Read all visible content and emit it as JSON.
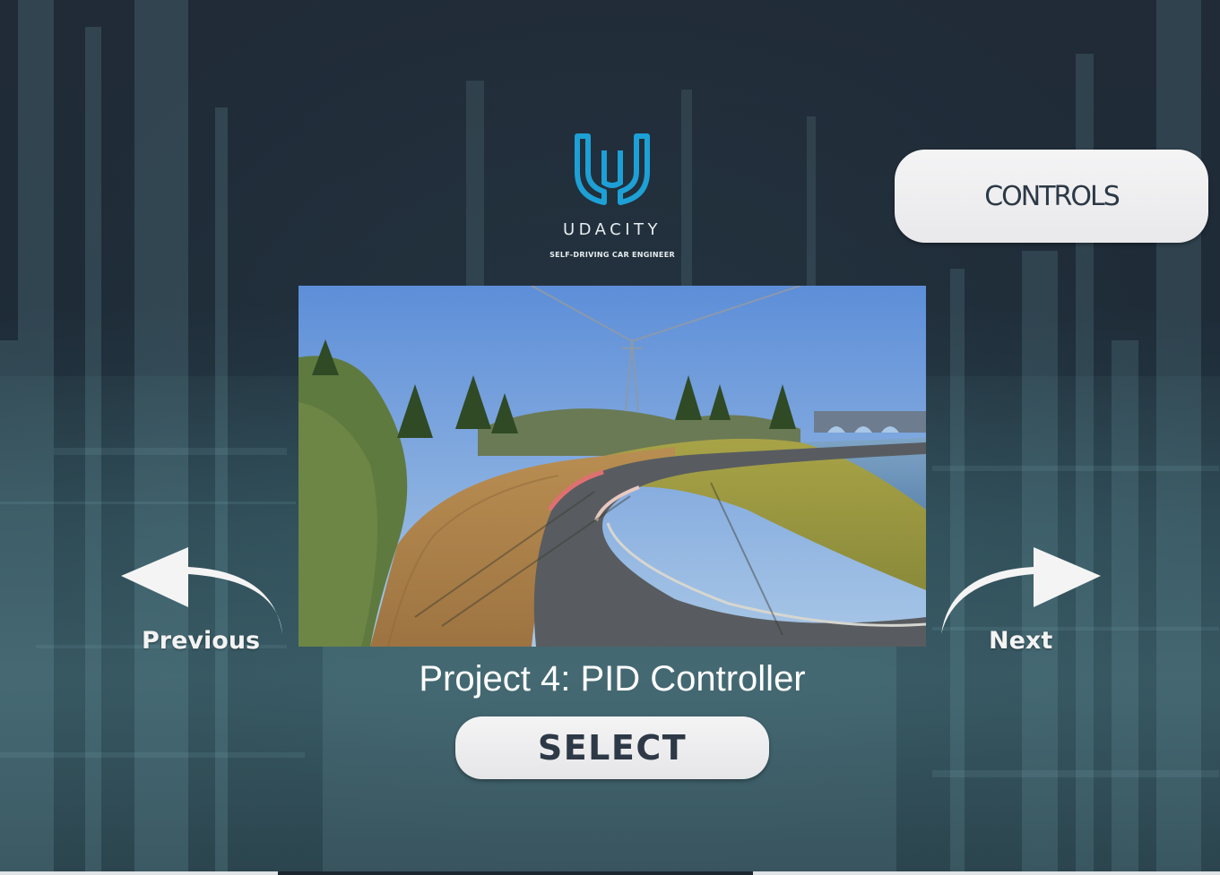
{
  "logo": {
    "wordmark": "UDACITY",
    "tagline": "SELF-DRIVING CAR ENGINEER",
    "icon": "udacity-u-logo",
    "color": "#1da0d6"
  },
  "header": {
    "controls_label": "CONTROLS"
  },
  "navigation": {
    "previous_label": "Previous",
    "next_label": "Next",
    "previous_icon": "curved-arrow-left-icon",
    "next_icon": "curved-arrow-right-icon"
  },
  "project": {
    "title": "Project 4: PID Controller",
    "preview_description_icon": "track-preview-image"
  },
  "actions": {
    "select_label": "SELECT"
  },
  "colors": {
    "background": "#233140",
    "button_bg": "#efeff0",
    "button_text": "#2d3946",
    "accent": "#1da0d6"
  }
}
